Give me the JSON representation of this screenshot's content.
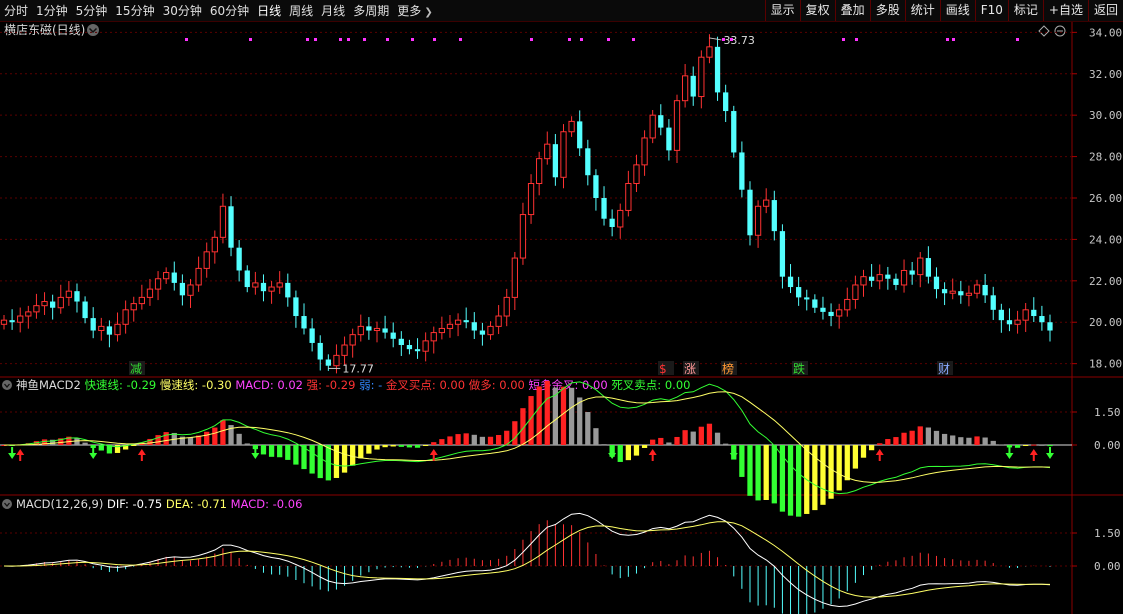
{
  "toolbar": {
    "periods": [
      "分时",
      "1分钟",
      "5分钟",
      "15分钟",
      "30分钟",
      "60分钟",
      "日线",
      "周线",
      "月线",
      "多周期",
      "更多"
    ],
    "active_period": "日线",
    "more_chevron": "chevron-right-icon",
    "right_buttons": [
      "显示",
      "复权",
      "叠加",
      "多股",
      "统计",
      "画线",
      "F10",
      "标记",
      "+自选",
      "返回"
    ]
  },
  "main_panel": {
    "title": "横店东磁(日线)",
    "title_chevron": "chevron-down-icon",
    "y_ticks": [
      "34.00",
      "32.00",
      "30.00",
      "28.00",
      "26.00",
      "24.00",
      "22.00",
      "20.00",
      "18.00"
    ],
    "high_label": "33.73",
    "low_label": "17.77",
    "signal_labels": [
      {
        "text": "减",
        "color": "#33dd33"
      },
      {
        "text": "$",
        "color": "#ff3333"
      },
      {
        "text": "涨",
        "color": "#ff9999"
      },
      {
        "text": "榜",
        "color": "#ff9933"
      },
      {
        "text": "跌",
        "color": "#33dd33"
      },
      {
        "text": "财",
        "color": "#88aaff"
      }
    ]
  },
  "indicator1": {
    "name": "神鱼MACD2",
    "items": [
      {
        "label": "快速线: -0.29",
        "color": "#33ff33"
      },
      {
        "label": "慢速线: -0.30",
        "color": "#ffff66"
      },
      {
        "label": "MACD: 0.02",
        "color": "#ff44ff"
      },
      {
        "label": "强: -0.29",
        "color": "#ff3333"
      },
      {
        "label": "弱: -",
        "color": "#3388ff"
      },
      {
        "label": "金叉买点: 0.00",
        "color": "#ff3333"
      },
      {
        "label": "做多: 0.00",
        "color": "#ff3333"
      },
      {
        "label": "短多金叉: 0.00",
        "color": "#ff44ff"
      },
      {
        "label": "死叉卖点: 0.00",
        "color": "#33ff33"
      }
    ],
    "y_ticks": [
      "1.50",
      "0.00"
    ]
  },
  "indicator2": {
    "name": "MACD(12,26,9)",
    "items": [
      {
        "label": "DIF: -0.75",
        "color": "#ffffff"
      },
      {
        "label": "DEA: -0.71",
        "color": "#ffff66"
      },
      {
        "label": "MACD: -0.06",
        "color": "#ff44ff"
      }
    ],
    "y_ticks": [
      "1.50",
      "0.00"
    ]
  },
  "chart_data": {
    "type": "candlestick",
    "y_range": [
      17.5,
      34.5
    ],
    "close": [
      20.1,
      20.0,
      20.3,
      20.5,
      20.8,
      21.0,
      20.7,
      21.2,
      21.5,
      21.0,
      20.2,
      19.6,
      19.8,
      19.4,
      19.9,
      20.6,
      20.9,
      21.2,
      21.6,
      22.1,
      22.4,
      21.9,
      21.3,
      21.8,
      22.6,
      23.4,
      24.1,
      25.6,
      23.6,
      22.5,
      21.7,
      21.9,
      21.5,
      21.7,
      21.9,
      21.2,
      20.3,
      19.7,
      19.0,
      18.2,
      17.9,
      18.4,
      18.9,
      19.4,
      19.8,
      19.6,
      19.7,
      19.5,
      19.2,
      18.9,
      18.7,
      18.6,
      19.1,
      19.5,
      19.7,
      19.9,
      20.1,
      20.0,
      19.6,
      19.4,
      19.8,
      20.3,
      21.2,
      23.1,
      25.2,
      26.7,
      27.9,
      28.6,
      27.0,
      29.2,
      29.7,
      28.4,
      27.1,
      26.0,
      25.0,
      24.6,
      25.4,
      26.7,
      27.6,
      28.9,
      30.0,
      29.4,
      28.3,
      30.7,
      31.9,
      30.9,
      32.8,
      33.3,
      31.1,
      30.2,
      28.2,
      26.4,
      24.2,
      25.6,
      25.9,
      24.4,
      22.2,
      21.7,
      21.2,
      21.1,
      20.7,
      20.5,
      20.3,
      20.6,
      21.1,
      21.8,
      22.2,
      22.0,
      22.3,
      22.1,
      21.8,
      22.5,
      22.3,
      23.1,
      22.2,
      21.6,
      21.4,
      21.5,
      21.3,
      21.4,
      21.8,
      21.3,
      20.6,
      20.1,
      19.9,
      20.1,
      20.6,
      20.3,
      20.0,
      19.6
    ]
  }
}
